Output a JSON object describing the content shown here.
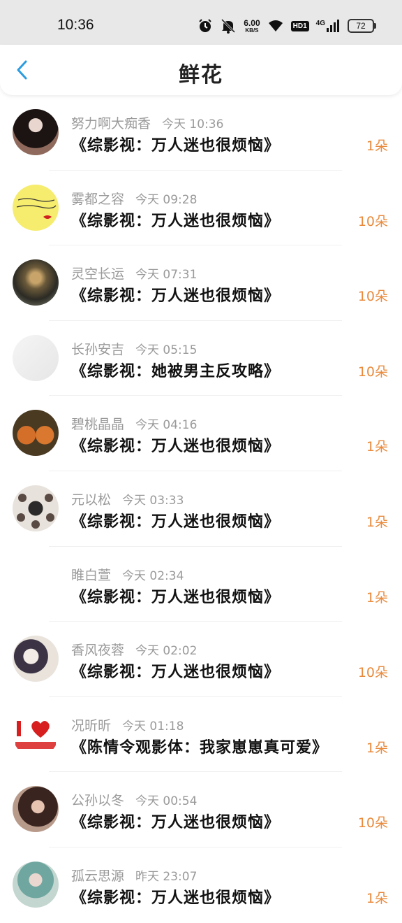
{
  "status_bar": {
    "time": "10:36",
    "net_speed_value": "6.00",
    "net_speed_unit": "KB/S",
    "hd_label": "HD1",
    "network_label": "4G",
    "battery": "72"
  },
  "header": {
    "title": "鲜花"
  },
  "colors": {
    "count": "#e98a3c",
    "back_arrow": "#2a9de0"
  },
  "items": [
    {
      "name": "努力啊大痴香",
      "time": "今天 10:36",
      "book": "《综影视：万人迷也很烦恼》",
      "count": "1朵"
    },
    {
      "name": "雾都之容",
      "time": "今天 09:28",
      "book": "《综影视：万人迷也很烦恼》",
      "count": "10朵"
    },
    {
      "name": "灵空长运",
      "time": "今天 07:31",
      "book": "《综影视：万人迷也很烦恼》",
      "count": "10朵"
    },
    {
      "name": "长孙安吉",
      "time": "今天 05:15",
      "book": "《综影视：她被男主反攻略》",
      "count": "10朵"
    },
    {
      "name": "碧桃晶晶",
      "time": "今天 04:16",
      "book": "《综影视：万人迷也很烦恼》",
      "count": "1朵"
    },
    {
      "name": "元以松",
      "time": "今天 03:33",
      "book": "《综影视：万人迷也很烦恼》",
      "count": "1朵"
    },
    {
      "name": "睢白萱",
      "time": "今天 02:34",
      "book": "《综影视：万人迷也很烦恼》",
      "count": "1朵"
    },
    {
      "name": "香风夜蓉",
      "time": "今天 02:02",
      "book": "《综影视：万人迷也很烦恼》",
      "count": "10朵"
    },
    {
      "name": "况昕昕",
      "time": "今天 01:18",
      "book": "《陈情令观影体：我家崽崽真可爱》",
      "count": "1朵"
    },
    {
      "name": "公孙以冬",
      "time": "今天 00:54",
      "book": "《综影视：万人迷也很烦恼》",
      "count": "10朵"
    },
    {
      "name": "孤云思源",
      "time": "昨天 23:07",
      "book": "《综影视：万人迷也很烦恼》",
      "count": "1朵"
    }
  ]
}
